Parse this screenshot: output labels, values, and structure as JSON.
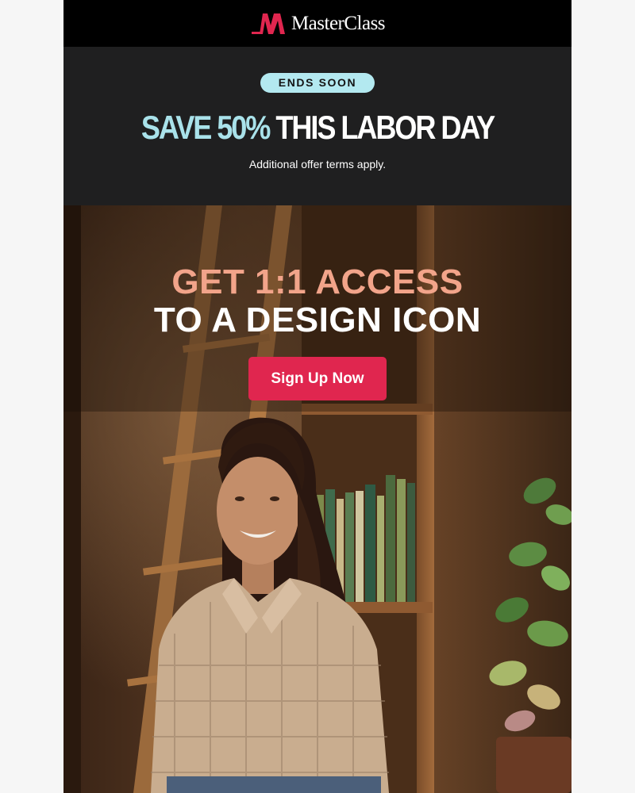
{
  "brand": {
    "name": "MasterClass",
    "logo_icon": "masterclass-m-logo",
    "logo_color": "#e0264f"
  },
  "promo": {
    "badge": "ENDS SOON",
    "headline_accent": "SAVE 50%",
    "headline_rest": "THIS LABOR DAY",
    "terms": "Additional offer terms apply.",
    "badge_color": "#b3e9f0",
    "accent_color": "#a9e2ea"
  },
  "hero": {
    "title_line1": "GET 1:1 ACCESS",
    "title_line2": "TO A DESIGN ICON",
    "cta_label": "Sign Up Now",
    "title_accent_color": "#f2a48a",
    "cta_color": "#e0264f"
  }
}
